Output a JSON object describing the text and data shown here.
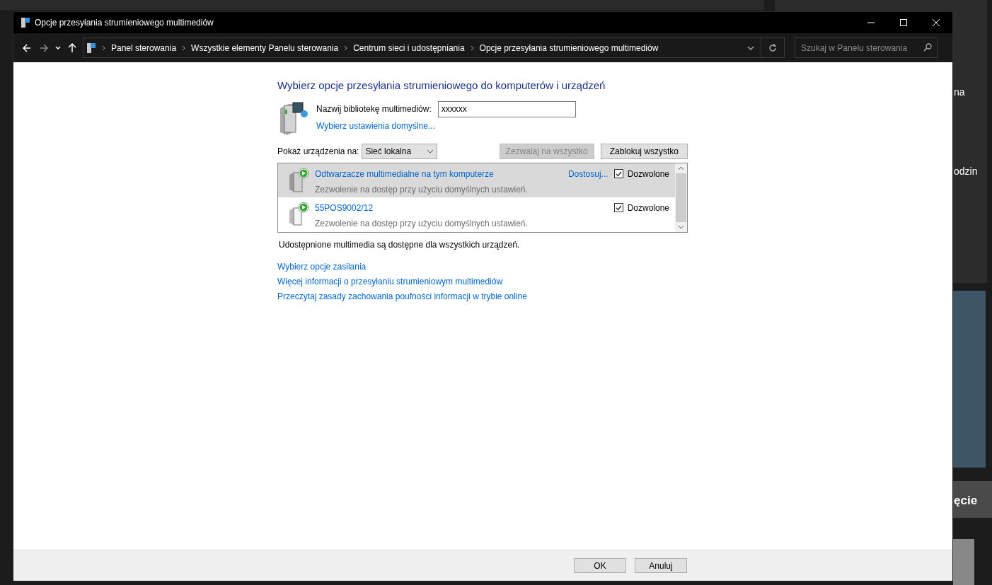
{
  "window": {
    "title": "Opcje przesyłania strumieniowego multimediów"
  },
  "breadcrumb": [
    "Panel sterowania",
    "Wszystkie elementy Panelu sterowania",
    "Centrum sieci i udostępniania",
    "Opcje przesyłania strumieniowego multimediów"
  ],
  "search": {
    "placeholder": "Szukaj w Panelu sterowania"
  },
  "heading": "Wybierz opcje przesyłania strumieniowego do komputerów i urządzeń",
  "library": {
    "label": "Nazwij bibliotekę multimediów:",
    "value": "xxxxxx",
    "defaults_link": "Wybierz ustawienia domyślne..."
  },
  "show_devices": {
    "label": "Pokaż urządzenia na:",
    "value": "Sieć lokalna"
  },
  "actions": [
    {
      "label": "Zezwalaj na wszystko",
      "disabled": true
    },
    {
      "label": "Zablokuj wszystko",
      "disabled": false
    }
  ],
  "devices": [
    {
      "kind": "computer",
      "name": "Odtwarzacze multimedialne na tym komputerze",
      "description": "Zezwolenie na dostęp przy użyciu domyślnych ustawień.",
      "customize_link": "Dostosuj...",
      "allowed_label": "Dozwolone",
      "checked": true,
      "selected": true
    },
    {
      "kind": "tv",
      "name": "55POS9002/12",
      "description": "Zezwolenie na dostęp przy użyciu domyślnych ustawień.",
      "allowed_label": "Dozwolone",
      "checked": true,
      "selected": false
    }
  ],
  "note": "Udostępnione multimedia są dostępne dla wszystkich urządzeń.",
  "links": [
    "Wybierz opcje zasilania",
    "Więcej informacji o przesyłaniu strumieniowym multimediów",
    "Przeczytaj zasady zachowania poufności informacji w trybie online"
  ],
  "buttons": [
    "OK",
    "Anuluj"
  ],
  "background": {
    "fragments": [
      "na",
      "odzin",
      "ęcie"
    ]
  }
}
